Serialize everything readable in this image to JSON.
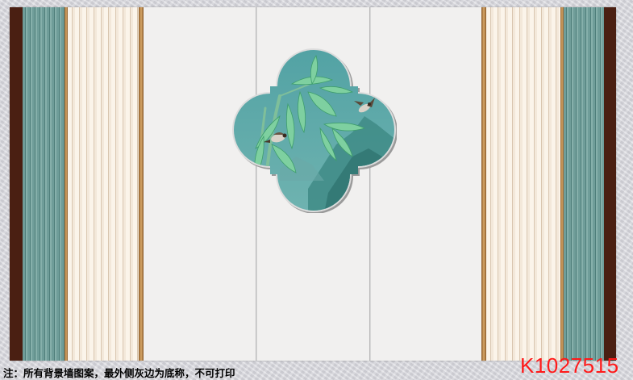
{
  "caption": "注：所有背景墙图案，最外侧灰边为底称，不可打印",
  "product_code": "K1027515",
  "colors": {
    "teal": "#6f9d99",
    "cream": "#fbf4ea",
    "brown": "#4a1f12",
    "gold": "#c8965a",
    "wall": "#f1f0ef",
    "window_sky": "#5fa9a9",
    "code_red": "#ff1a1a"
  },
  "motifs": [
    "bamboo",
    "birds",
    "mountains"
  ]
}
